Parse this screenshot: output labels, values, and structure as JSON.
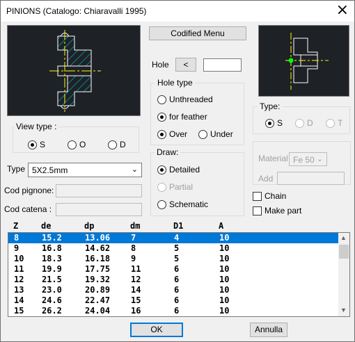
{
  "window": {
    "title": "PINIONS (Catalogo: Chiaravalli 1995)"
  },
  "buttons": {
    "codified_menu": "Codified Menu",
    "hole_prev": "<",
    "ok": "OK",
    "cancel": "Annulla"
  },
  "hole": {
    "label": "Hole",
    "value": ""
  },
  "hole_type": {
    "label": "Hole type",
    "unthreaded": "Unthreaded",
    "for_feather": "for feather",
    "over": "Over",
    "under": "Under",
    "selected": [
      "for feather",
      "Over"
    ]
  },
  "draw": {
    "label": "Draw:",
    "detailed": "Detailed",
    "partial": "Partial",
    "schematic": "Schematic",
    "selected": "Detailed"
  },
  "view_type": {
    "label": "View type  :",
    "options": [
      "S",
      "O",
      "D"
    ],
    "selected": "S"
  },
  "type_right": {
    "label": "Type:",
    "options": [
      "S",
      "D",
      "T"
    ],
    "selected": "S"
  },
  "type_select": {
    "label": "Type",
    "value": "5X2.5mm"
  },
  "fields": {
    "cod_pignone": "Cod pignone:",
    "cod_catena": "Cod catena :"
  },
  "material": {
    "label": "Material",
    "value": "Fe 50",
    "add_label": "Add"
  },
  "checkboxes": {
    "chain": "Chain",
    "make_part": "Make part"
  },
  "table": {
    "columns": [
      "Z",
      "de",
      "dp",
      "dm",
      "D1",
      "A"
    ],
    "rows": [
      [
        "8",
        "15.2",
        "13.06",
        "7",
        "4",
        "10"
      ],
      [
        "9",
        "16.8",
        "14.62",
        "8",
        "5",
        "10"
      ],
      [
        "10",
        "18.3",
        "16.18",
        "9",
        "5",
        "10"
      ],
      [
        "11",
        "19.9",
        "17.75",
        "11",
        "6",
        "10"
      ],
      [
        "12",
        "21.5",
        "19.32",
        "12",
        "6",
        "10"
      ],
      [
        "13",
        "23.0",
        "20.89",
        "14",
        "6",
        "10"
      ],
      [
        "14",
        "24.6",
        "22.47",
        "15",
        "6",
        "10"
      ],
      [
        "15",
        "26.2",
        "24.04",
        "16",
        "6",
        "10"
      ]
    ],
    "selected_row": 0
  },
  "colors": {
    "preview_bg": "#1e2126",
    "hatch": "#00b7c3",
    "outline": "#ffffff",
    "axis": "#ffff00",
    "point": "#00ff00",
    "selection": "#0078d7"
  }
}
